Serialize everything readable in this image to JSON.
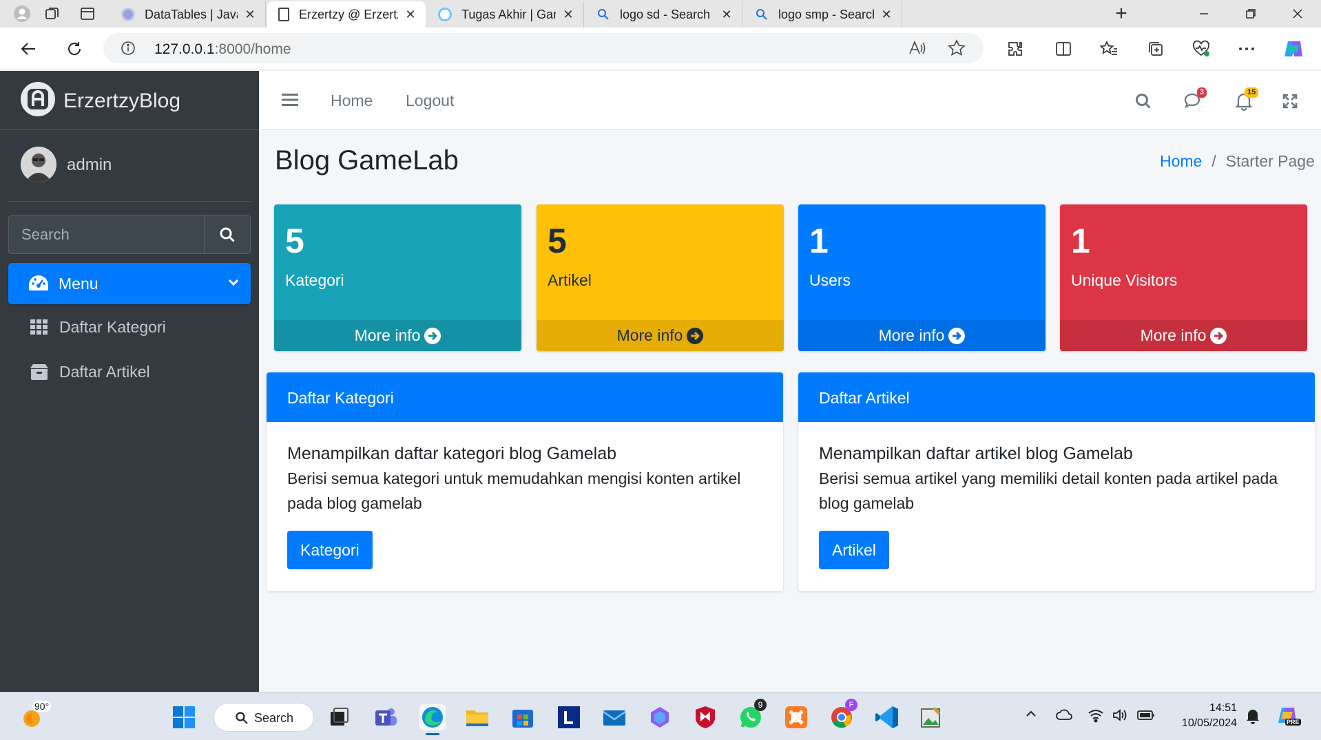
{
  "browser": {
    "tabs": [
      {
        "title": "DataTables | Javascript t",
        "active": false
      },
      {
        "title": "Erzertzy @ ErzertzyBlog",
        "active": true
      },
      {
        "title": "Tugas Akhir | Gamelab.i",
        "active": false
      },
      {
        "title": "logo sd - Search",
        "active": false
      },
      {
        "title": "logo smp - Search Imag",
        "active": false
      }
    ],
    "tab_close": "✕",
    "new_tab": "+",
    "url_host": "127.0.0.1",
    "url_rest": ":8000/home"
  },
  "sidebar": {
    "brand": "ErzertzyBlog",
    "user": "admin",
    "search_placeholder": "Search",
    "menu_label": "Menu",
    "items": [
      {
        "label": "Daftar Kategori",
        "icon": "th-icon"
      },
      {
        "label": "Daftar Artikel",
        "icon": "box-icon"
      }
    ]
  },
  "topnav": {
    "links": [
      "Home",
      "Logout"
    ],
    "messages_badge": "3",
    "notifications_badge": "15"
  },
  "content": {
    "title": "Blog GameLab",
    "breadcrumb": {
      "home": "Home",
      "sep": "/",
      "current": "Starter Page"
    },
    "stats": [
      {
        "value": "5",
        "label": "Kategori",
        "more": "More info",
        "color": "#17a2b8",
        "foot": "#1591a5"
      },
      {
        "value": "5",
        "label": "Artikel",
        "more": "More info",
        "color": "#ffc107",
        "foot": "#e5ad06"
      },
      {
        "value": "1",
        "label": "Users",
        "more": "More info",
        "color": "#007bff",
        "foot": "#006fe6"
      },
      {
        "value": "1",
        "label": "Unique Visitors",
        "more": "More info",
        "color": "#dc3545",
        "foot": "#c6303e"
      }
    ],
    "cards": [
      {
        "header": "Daftar Kategori",
        "title": "Menampilkan daftar kategori blog Gamelab",
        "desc_line1": "Berisi semua kategori untuk memudahkan mengisi konten artikel",
        "desc_line2": "pada blog gamelab",
        "button": "Kategori"
      },
      {
        "header": "Daftar Artikel",
        "title": "Menampilkan daftar artikel blog Gamelab",
        "desc_line1": "Berisi semua artikel yang memiliki detail konten pada artikel pada",
        "desc_line2": "blog gamelab",
        "button": "Artikel"
      }
    ]
  },
  "taskbar": {
    "weather": "90°",
    "search": "Search",
    "whatsapp_badge": "9",
    "chrome_badge": "F",
    "time": "14:51",
    "date": "10/05/2024",
    "copilot_badge": "PRE"
  }
}
